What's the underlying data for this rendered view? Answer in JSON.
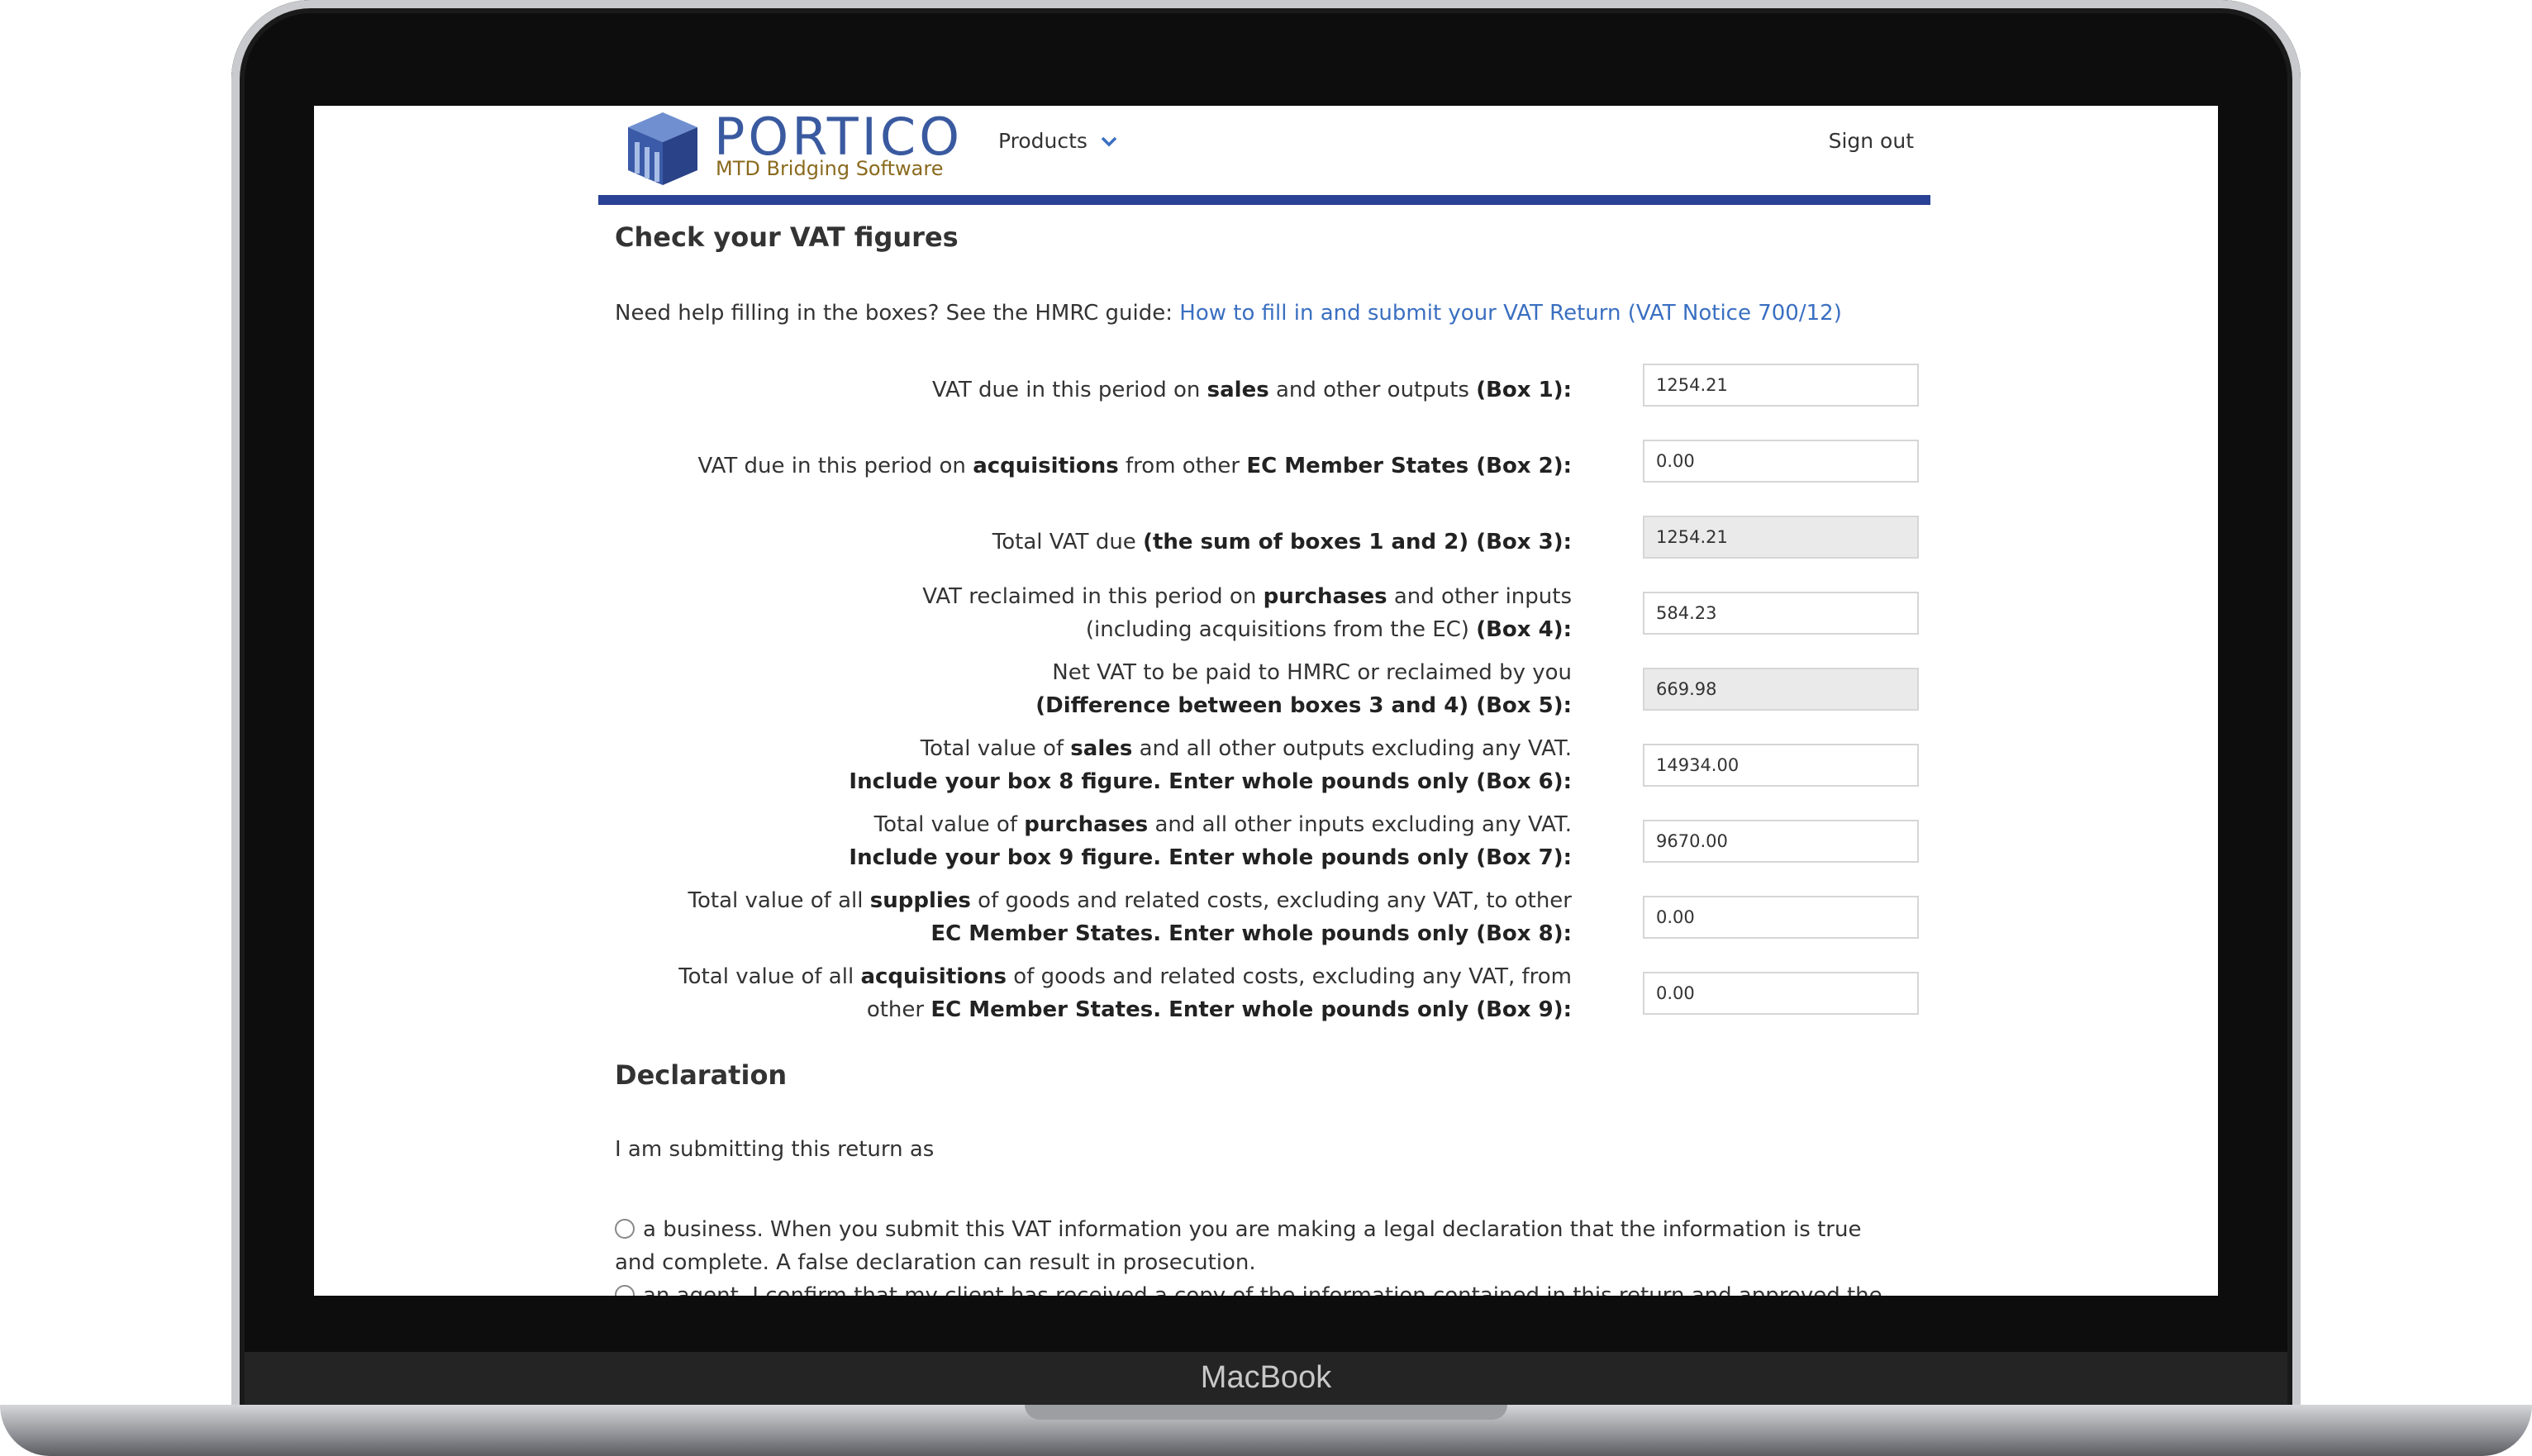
{
  "device": {
    "label": "MacBook"
  },
  "header": {
    "brand": "PORTICO",
    "tagline": "MTD Bridging Software",
    "products_label": "Products",
    "signout_label": "Sign out"
  },
  "main": {
    "title": "Check your VAT figures",
    "help_prefix": "Need help filling in the boxes? See the HMRC guide: ",
    "help_link": "How to fill in and submit your VAT Return (VAT Notice 700/12)",
    "boxes": [
      {
        "line1": [
          {
            "t": "VAT due in this period on "
          },
          {
            "b": "sales"
          },
          {
            "t": " and other outputs "
          },
          {
            "b": "(Box 1):"
          }
        ],
        "line2": [],
        "value": "1254.21",
        "readonly": false
      },
      {
        "line1": [
          {
            "t": "VAT due in this period on "
          },
          {
            "b": "acquisitions"
          },
          {
            "t": " from other "
          },
          {
            "b": "EC Member States (Box 2):"
          }
        ],
        "line2": [],
        "value": "0.00",
        "readonly": false
      },
      {
        "line1": [
          {
            "t": "Total VAT due "
          },
          {
            "b": "(the sum of boxes 1 and 2) (Box 3):"
          }
        ],
        "line2": [],
        "value": "1254.21",
        "readonly": true
      },
      {
        "line1": [
          {
            "t": "VAT reclaimed in this period on "
          },
          {
            "b": "purchases"
          },
          {
            "t": " and other inputs"
          }
        ],
        "line2": [
          {
            "t": "(including acquisitions from the EC) "
          },
          {
            "b": "(Box 4):"
          }
        ],
        "value": "584.23",
        "readonly": false
      },
      {
        "line1": [
          {
            "t": "Net VAT to be paid to HMRC or reclaimed by you"
          }
        ],
        "line2": [
          {
            "b": "(Difference between boxes 3 and 4) (Box 5):"
          }
        ],
        "value": "669.98",
        "readonly": true
      },
      {
        "line1": [
          {
            "t": "Total value of "
          },
          {
            "b": "sales"
          },
          {
            "t": " and all other outputs excluding any VAT."
          }
        ],
        "line2": [
          {
            "b": "Include your box 8 figure. Enter whole pounds only (Box 6):"
          }
        ],
        "value": "14934.00",
        "readonly": false
      },
      {
        "line1": [
          {
            "t": "Total value of "
          },
          {
            "b": "purchases"
          },
          {
            "t": " and all other inputs excluding any VAT."
          }
        ],
        "line2": [
          {
            "b": "Include your box 9 figure. Enter whole pounds only (Box 7):"
          }
        ],
        "value": "9670.00",
        "readonly": false
      },
      {
        "line1": [
          {
            "t": "Total value of all "
          },
          {
            "b": "supplies"
          },
          {
            "t": " of goods and related costs, excluding any VAT, to other"
          }
        ],
        "line2": [
          {
            "b": "EC Member States. Enter whole pounds only (Box 8):"
          }
        ],
        "value": "0.00",
        "readonly": false
      },
      {
        "line1": [
          {
            "t": "Total value of all "
          },
          {
            "b": "acquisitions"
          },
          {
            "t": " of goods and related costs, excluding any VAT, from"
          }
        ],
        "line2": [
          {
            "t": "other "
          },
          {
            "b": "EC Member States. Enter whole pounds only (Box 9):"
          }
        ],
        "value": "0.00",
        "readonly": false
      }
    ]
  },
  "declaration": {
    "title": "Declaration",
    "intro": "I am submitting this return as",
    "options": [
      {
        "line1": "a business. When you submit this VAT information you are making a legal declaration that the information is true",
        "line2": "and complete. A false declaration can result in prosecution."
      },
      {
        "line1": "an agent. I confirm that my client has received a copy of the information contained in this return and approved the",
        "line2": ""
      }
    ]
  },
  "colors": {
    "brand_blue": "#3a5aa0",
    "header_rule": "#2a4195",
    "link": "#3a6fc1",
    "tagline_gold": "#8a6a1e"
  }
}
